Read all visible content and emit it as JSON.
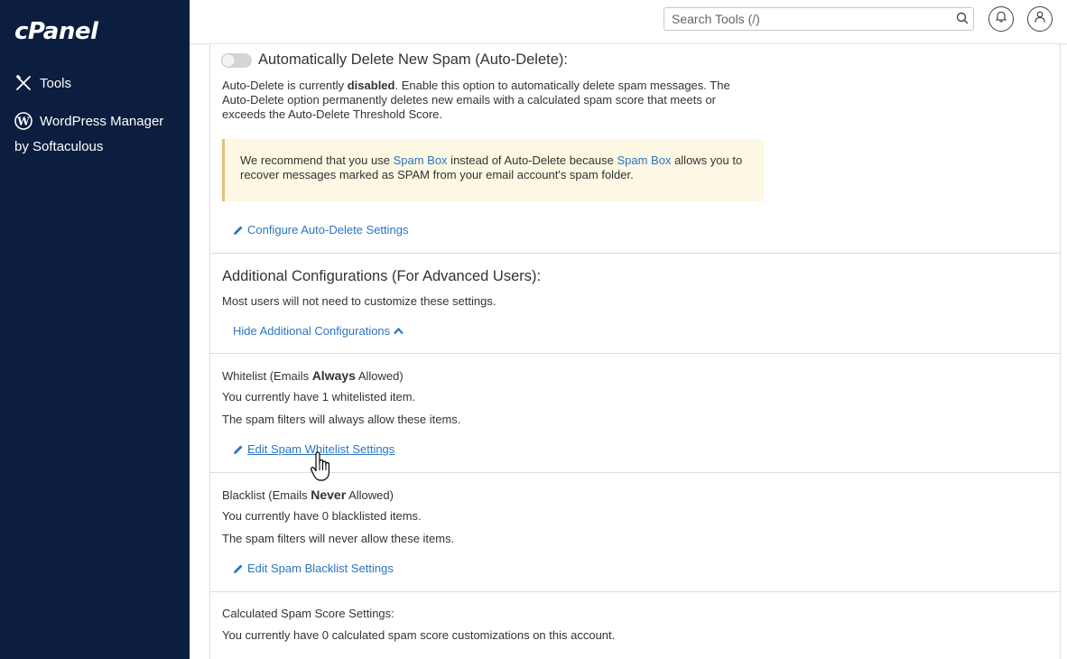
{
  "sidebar": {
    "logo": "cPanel",
    "items": [
      {
        "label": "Tools",
        "icon": "tools-icon"
      },
      {
        "label": "WordPress Manager",
        "icon": "wordpress-icon",
        "sublabel": "by Softaculous"
      }
    ]
  },
  "topbar": {
    "search_placeholder": "Search Tools (/)",
    "search_icon": "search-icon",
    "notifications_icon": "bell-icon",
    "user_icon": "user-icon"
  },
  "auto_delete": {
    "title": "Automatically Delete New Spam (Auto-Delete):",
    "toggle_state": "off",
    "desc_prefix": "Auto-Delete is currently ",
    "desc_status": "disabled",
    "desc_line1_rest": ". Enable this option to automatically delete spam messages. The",
    "desc_line2": "Auto-Delete option permanently deletes new emails with a calculated spam score that meets or",
    "desc_line3": "exceeds the Auto-Delete Threshold Score.",
    "alert": {
      "part1": "We recommend that you use ",
      "link1": "Spam Box",
      "part2": " instead of Auto-Delete because ",
      "link2": "Spam Box",
      "part3": " allows you to",
      "line2": "recover messages marked as SPAM from your email account's spam folder."
    },
    "configure_link": "Configure Auto-Delete Settings"
  },
  "additional": {
    "title": "Additional Configurations (For Advanced Users):",
    "desc": "Most users will not need to customize these settings.",
    "toggle_link": "Hide Additional Configurations"
  },
  "whitelist": {
    "label_prefix": "Whitelist (Emails ",
    "label_bold": "Always",
    "label_suffix": " Allowed)",
    "count_text": "You currently have 1 whitelisted item.",
    "desc": "The spam filters will always allow these items.",
    "edit_link": "Edit Spam Whitelist Settings"
  },
  "blacklist": {
    "label_prefix": "Blacklist (Emails ",
    "label_bold": "Never",
    "label_suffix": " Allowed)",
    "count_text": "You currently have 0 blacklisted items.",
    "desc": "The spam filters will never allow these items.",
    "edit_link": "Edit Spam Blacklist Settings"
  },
  "spam_score": {
    "title": "Calculated Spam Score Settings:",
    "desc": "You currently have 0 calculated spam score customizations on this account."
  },
  "colors": {
    "sidebar_bg": "#0b1e3f",
    "link": "#2a76c0",
    "alert_bg": "#fcf8e3",
    "alert_border": "#e2c27a"
  }
}
